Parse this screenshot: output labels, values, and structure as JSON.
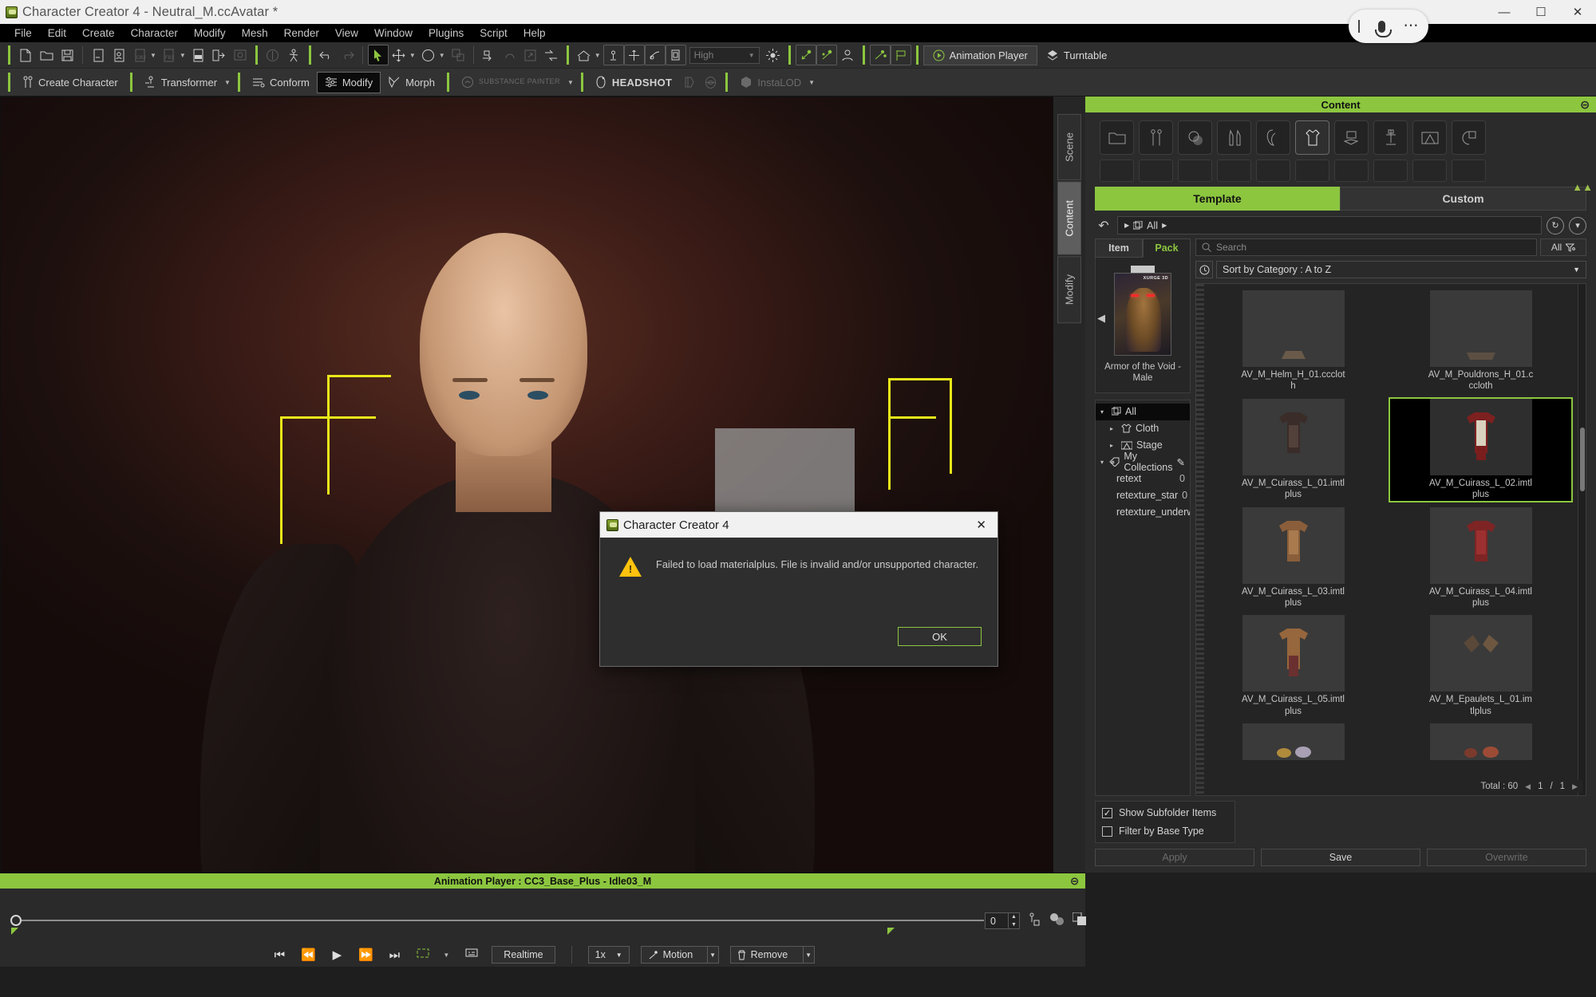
{
  "window": {
    "title": "Character Creator 4 - Neutral_M.ccAvatar *",
    "app_icon": "cc4-logo-icon",
    "minimize": "—",
    "maximize": "☐",
    "close": "✕"
  },
  "recorder": {
    "mic_icon": "microphone-icon",
    "more_icon": "more-options-icon"
  },
  "menu": {
    "items": [
      "File",
      "Edit",
      "Create",
      "Character",
      "Modify",
      "Mesh",
      "Render",
      "View",
      "Window",
      "Plugins",
      "Script",
      "Help"
    ]
  },
  "toolbar_main": {
    "quality_combo": "High",
    "animation_player_label": "Animation Player",
    "turntable_label": "Turntable",
    "icons": [
      "new-file-icon",
      "open-folder-icon",
      "save-icon",
      "new-project-icon",
      "load-character-icon",
      "import-obj-icon",
      "import-fbx-icon",
      "import-usd-icon",
      "export-icon",
      "screenshot-icon",
      "preview-icon",
      "pose-icon",
      "undo-icon",
      "redo-icon",
      "select-tool-icon",
      "move-tool-icon",
      "rotate-tool-icon",
      "scale-tool-icon",
      "pivot-icon",
      "home-view-icon",
      "light-icon",
      "grid-icon",
      "frame-icon",
      "box-icon",
      "sun-icon",
      "ik-icon",
      "motion-icon",
      "avatar-icon",
      "edit-motion-icon",
      "flag-icon"
    ]
  },
  "toolbar_modes": {
    "tabs": [
      {
        "label": "Create Character",
        "icon": "create-character-icon",
        "state": "normal",
        "caret": false
      },
      {
        "label": "Transformer",
        "icon": "transformer-icon",
        "state": "normal",
        "caret": true
      },
      {
        "label": "Conform",
        "icon": "conform-icon",
        "state": "normal",
        "caret": false
      },
      {
        "label": "Modify",
        "icon": "modify-icon",
        "state": "selected",
        "caret": false
      },
      {
        "label": "Morph",
        "icon": "morph-icon",
        "state": "normal",
        "caret": false
      },
      {
        "label": "SUBSTANCE PAINTER",
        "icon": "substance-painter-icon",
        "state": "disabled",
        "caret": true
      },
      {
        "label": "HEADSHOT",
        "icon": "headshot-icon",
        "state": "normal",
        "caret": false
      },
      {
        "label": "InstaLOD",
        "icon": "instalod-icon",
        "state": "disabled",
        "caret": true
      }
    ],
    "extra_icons": [
      "sculpt-icon",
      "head-icon"
    ]
  },
  "side_tabs": [
    {
      "label": "Scene",
      "active": false
    },
    {
      "label": "Content",
      "active": true
    },
    {
      "label": "Modify",
      "active": false
    }
  ],
  "dialog": {
    "title": "Character Creator 4",
    "icon": "cc4-logo-icon",
    "close_icon": "close-icon",
    "warning_icon": "warning-triangle-icon",
    "message": "Failed to load materialplus. File is invalid and/or unsupported character.",
    "ok_label": "OK"
  },
  "content_panel": {
    "title": "Content",
    "close_icon": "close-icon",
    "category_icons": [
      "folder-icon",
      "body-icon",
      "skin-icon",
      "makeup-icon",
      "hair-icon",
      "cloth-icon",
      "accessory-icon",
      "prop-icon",
      "stage-icon",
      "lighting-icon"
    ],
    "collapse_icon": "collapse-up-icon",
    "tabs": [
      {
        "label": "Template",
        "active": true
      },
      {
        "label": "Custom",
        "active": false
      }
    ],
    "path": {
      "back_icon": "back-arrow-icon",
      "breadcrumb": "All",
      "refresh_icon": "refresh-icon",
      "dropdown_icon": "chevron-down-icon"
    },
    "item_pack_tabs": [
      {
        "label": "Item",
        "active": false
      },
      {
        "label": "Pack",
        "active": true
      }
    ],
    "pack": {
      "name": "Armor of the Void - Male",
      "brand": "XURGE 3D",
      "prev_icon": "previous-arrow-icon"
    },
    "tree": [
      {
        "label": "All",
        "count": "",
        "indent": 0,
        "expanded": true,
        "selected": true,
        "icon": "all-items-icon"
      },
      {
        "label": "Cloth",
        "count": "",
        "indent": 1,
        "expanded": false,
        "selected": false,
        "icon": "cloth-icon"
      },
      {
        "label": "Stage",
        "count": "",
        "indent": 1,
        "expanded": false,
        "selected": false,
        "icon": "stage-icon"
      },
      {
        "label": "My Collections",
        "count": "",
        "indent": 0,
        "expanded": true,
        "selected": false,
        "icon": "collections-icon",
        "pencil": true
      },
      {
        "label": "retext",
        "count": "0",
        "indent": 2,
        "expanded": null,
        "selected": false,
        "icon": ""
      },
      {
        "label": "retexture_star",
        "count": "0",
        "indent": 2,
        "expanded": null,
        "selected": false,
        "icon": ""
      },
      {
        "label": "retexture_underwear",
        "count": "0",
        "indent": 2,
        "expanded": null,
        "selected": false,
        "icon": ""
      }
    ],
    "search": {
      "placeholder": "Search",
      "value": "",
      "icon": "search-icon"
    },
    "filter": {
      "label": "All",
      "icon": "filter-icon"
    },
    "sort": {
      "label": "Sort by Category : A to Z",
      "history_icon": "history-clock-icon",
      "caret": "▼"
    },
    "items": [
      {
        "label": "AV_M_Helm_H_01.cccloth",
        "selected": false,
        "cut": true
      },
      {
        "label": "AV_M_Pouldrons_H_01.cccloth",
        "selected": false,
        "cut": true
      },
      {
        "label": "AV_M_Cuirass_L_01.imtlplus",
        "selected": false,
        "cut": false
      },
      {
        "label": "AV_M_Cuirass_L_02.imtlplus",
        "selected": true,
        "cut": false
      },
      {
        "label": "AV_M_Cuirass_L_03.imtlplus",
        "selected": false,
        "cut": false
      },
      {
        "label": "AV_M_Cuirass_L_04.imtlplus",
        "selected": false,
        "cut": false
      },
      {
        "label": "AV_M_Cuirass_L_05.imtlplus",
        "selected": false,
        "cut": false
      },
      {
        "label": "AV_M_Epaulets_L_01.imtlplus",
        "selected": false,
        "cut": false
      }
    ],
    "pagination": {
      "total_label": "Total : 60",
      "page": "1",
      "sep": "/",
      "pages": "1",
      "prev_icon": "prev-page-icon",
      "next_icon": "next-page-icon"
    },
    "checkboxes": [
      {
        "label": "Show Subfolder Items",
        "checked": true
      },
      {
        "label": "Filter by Base Type",
        "checked": false
      }
    ],
    "actions": [
      {
        "label": "Apply",
        "enabled": false
      },
      {
        "label": "Save",
        "enabled": true
      },
      {
        "label": "Overwrite",
        "enabled": false
      }
    ]
  },
  "animation_player": {
    "title": "Animation Player : CC3_Base_Plus - Idle03_M",
    "close_icon": "close-icon",
    "frame_value": "0",
    "transport": [
      {
        "icon": "jump-start-icon",
        "glyph": "⏮"
      },
      {
        "icon": "rewind-icon",
        "glyph": "⏪"
      },
      {
        "icon": "play-icon",
        "glyph": "▶"
      },
      {
        "icon": "fast-forward-icon",
        "glyph": "⏩"
      },
      {
        "icon": "jump-end-icon",
        "glyph": "⏭"
      },
      {
        "icon": "loop-icon",
        "glyph": "↺"
      },
      {
        "icon": "subtitle-icon",
        "glyph": "⌨"
      }
    ],
    "realtime_label": "Realtime",
    "speed_label": "1x",
    "motion_label": "Motion",
    "motion_icon": "motion-icon",
    "remove_label": "Remove",
    "remove_icon": "trash-icon",
    "right_icons": [
      "ik-pose-icon",
      "blend-icon",
      "duplicate-icon"
    ]
  }
}
